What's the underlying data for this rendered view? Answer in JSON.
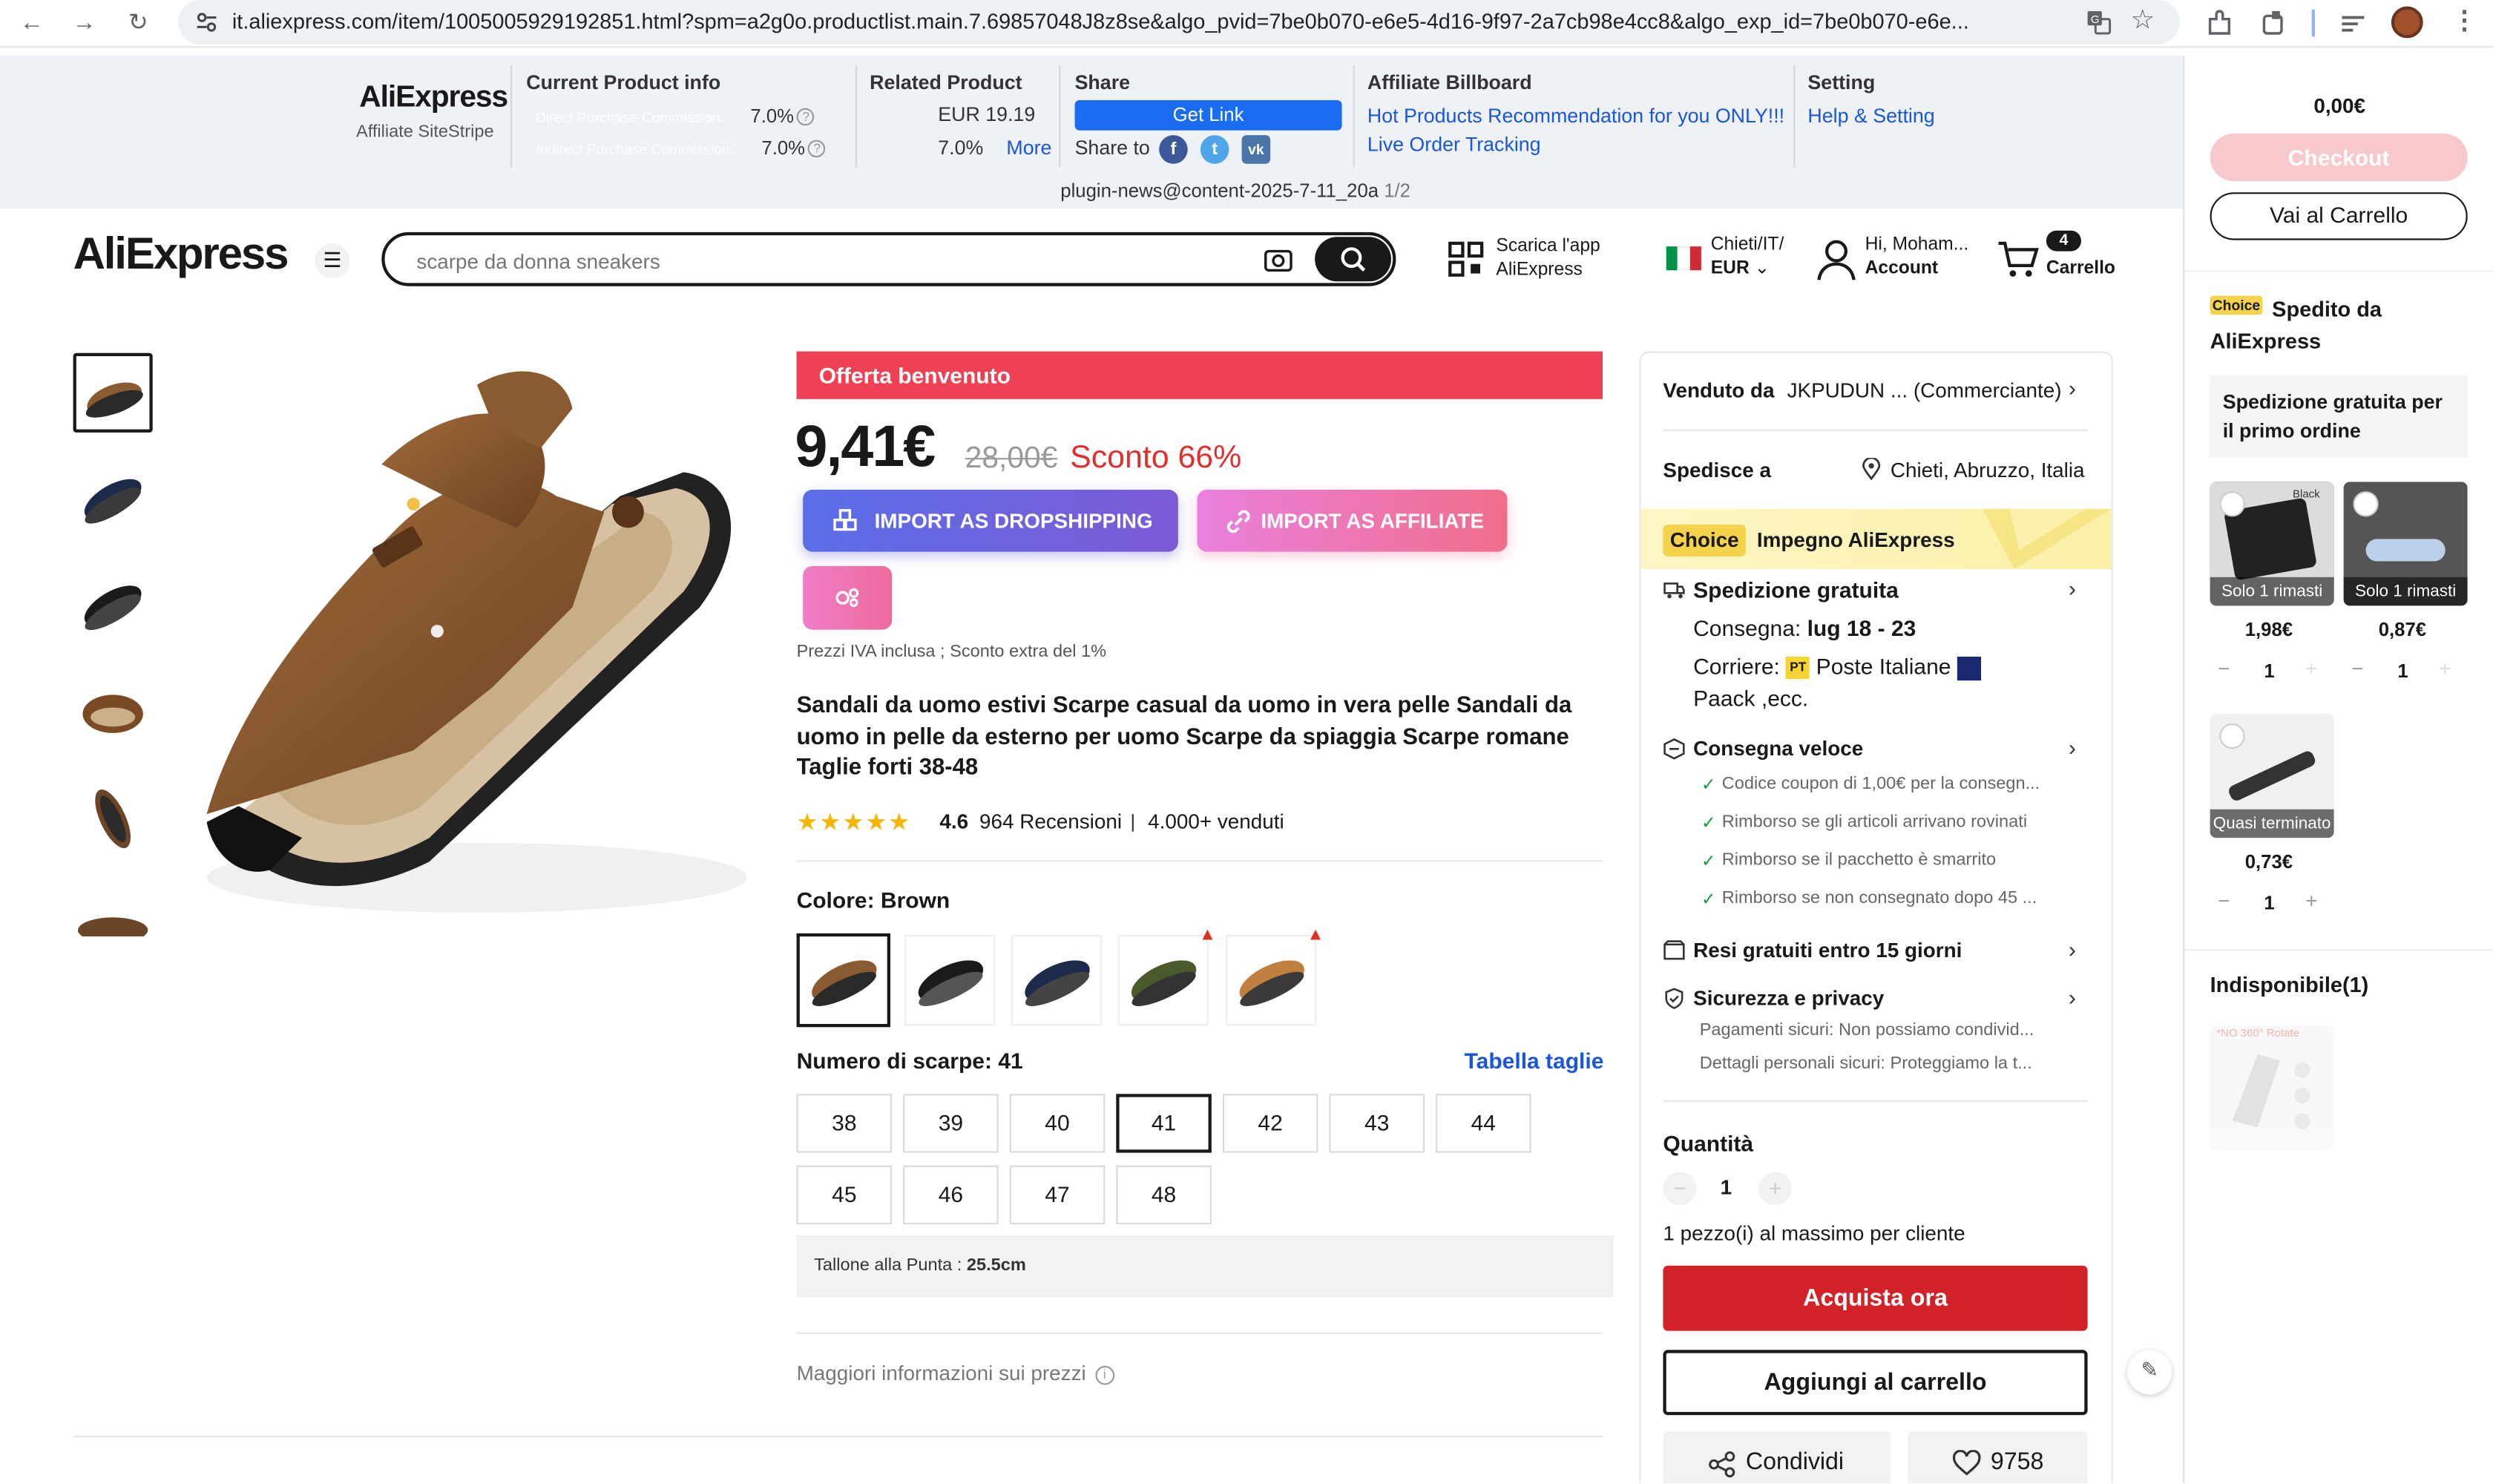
{
  "browser": {
    "url": "it.aliexpress.com/item/1005005929192851.html?spm=a2g0o.productlist.main.7.69857048J8z8se&algo_pvid=7be0b070-e6e5-4d16-9f97-2a7cb98e4cc8&algo_exp_id=7be0b070-e6e..."
  },
  "sitestripe": {
    "logo": "AliExpress",
    "logo_sub": "Affiliate SiteStripe",
    "current_title": "Current Product info",
    "direct_label": "Direct Purchase Commission:",
    "direct_value": "7.0%",
    "indirect_label": "Indirect Purchase Commission:",
    "indirect_value": "7.0%",
    "related_title": "Related Product",
    "related_price": "EUR 19.19",
    "related_pct": "7.0%",
    "related_more": "More",
    "share_title": "Share",
    "get_link": "Get Link",
    "share_to": "Share to",
    "billboard_title": "Affiliate Billboard",
    "billboard_link1": "Hot Products Recommendation for you ONLY!!!",
    "billboard_link2": "Live Order Tracking",
    "setting_title": "Setting",
    "setting_link": "Help & Setting",
    "news": "plugin-news@content-2025-7-11_20a",
    "news_page": "1/2"
  },
  "header": {
    "logo": "AliExpress",
    "search_placeholder": "scarpe da donna sneakers",
    "app_line1": "Scarica l'app",
    "app_line2": "AliExpress",
    "region_line1": "Chieti/IT/",
    "region_line2": "EUR",
    "account_line1": "Hi, Moham...",
    "account_line2": "Account",
    "cart_count": "4",
    "cart_label": "Carrello"
  },
  "product": {
    "welcome_banner": "Offerta benvenuto",
    "price": "9,41€",
    "old_price": "28,00€",
    "discount": "Sconto 66%",
    "btn_dropshipping": "IMPORT AS DROPSHIPPING",
    "btn_affiliate": "IMPORT AS AFFILIATE",
    "vat_note": "Prezzi IVA inclusa ; Sconto extra del 1%",
    "title": "Sandali da uomo estivi Scarpe casual da uomo in vera pelle Sandali da uomo in pelle da esterno per uomo Scarpe da spiaggia Scarpe romane Taglie forti 38-48",
    "rating": "4.6",
    "rating_fraction": 0.92,
    "reviews": "964 Recensioni",
    "sold": "4.000+ venduti",
    "color_label": "Colore: Brown",
    "size_label": "Numero di scarpe: 41",
    "size_table": "Tabella taglie",
    "sizes": [
      "38",
      "39",
      "40",
      "41",
      "42",
      "43",
      "44",
      "45",
      "46",
      "47",
      "48"
    ],
    "selected_size": "41",
    "heel_label": "Tallone alla Punta :",
    "heel_value": "25.5cm",
    "more_price_info": "Maggiori informazioni sui prezzi"
  },
  "buybox": {
    "seller_label": "Venduto da",
    "seller_name": "JKPUDUN ... (Commerciante)",
    "ship_label": "Spedisce a",
    "ship_dest": "Chieti, Abruzzo, Italia",
    "choice_badge": "Choice",
    "choice_text": "Impegno AliExpress",
    "free_ship": "Spedizione gratuita",
    "delivery_label": "Consegna:",
    "delivery_date": "lug 18 - 23",
    "courier_label": "Corriere:",
    "courier_pt": "PT",
    "courier_name": "Poste Italiane",
    "courier_more": "Paack ,ecc.",
    "fast_delivery": "Consegna veloce",
    "perks": [
      "Codice coupon di 1,00€ per la consegn...",
      "Rimborso se gli articoli arrivano rovinati",
      "Rimborso se il pacchetto è smarrito",
      "Rimborso se non consegnato dopo 45 ..."
    ],
    "returns": "Resi gratuiti entro 15 giorni",
    "security": "Sicurezza e privacy",
    "security_line1": "Pagamenti sicuri: Non possiamo condivid...",
    "security_line2": "Dettagli personali sicuri: Proteggiamo la t...",
    "qty_label": "Quantità",
    "qty_value": "1",
    "qty_note": "1 pezzo(i) al massimo per cliente",
    "buy_now": "Acquista ora",
    "add_cart": "Aggiungi al carrello",
    "share": "Condividi",
    "wishlist_count": "9758"
  },
  "cartpanel": {
    "total": "0,00€",
    "checkout": "Checkout",
    "go_cart": "Vai al Carrello",
    "choice_badge": "Choice",
    "choice_title": "Spedito da AliExpress",
    "free_first": "Spedizione gratuita per il primo ordine",
    "items": [
      {
        "tag": "Solo 1 rimasti",
        "price": "1,98€",
        "qty": "1",
        "variant": "Black"
      },
      {
        "tag": "Solo 1 rimasti",
        "price": "0,87€",
        "qty": "1"
      },
      {
        "tag": "Quasi terminato",
        "price": "0,73€",
        "qty": "1"
      }
    ],
    "unavailable": "Indisponibile(1)",
    "unavail_img_text": "*NO 360° Rotate"
  },
  "colors": {
    "accent_red": "#e02f2f",
    "buy_red": "#d32227",
    "link_blue": "#1a56db",
    "banner_red": "#ee4154"
  }
}
